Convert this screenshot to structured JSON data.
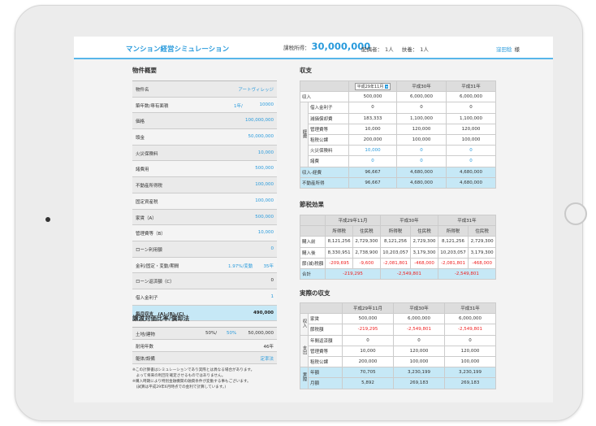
{
  "header": {
    "app_title": "マンション経営シミュレーション",
    "income_label": "課税所得：",
    "income_value": "30,000,000",
    "spouse_label": "配偶者：",
    "spouse_value": "1人",
    "dependents_label": "扶養：",
    "dependents_value": "1人",
    "user_name": "窪田稔",
    "honorific": "様"
  },
  "property": {
    "title": "物件概要",
    "name_label": "物件名",
    "name_value": "アートヴィレッジ",
    "age_label": "築年数/専有面積",
    "age_value": "1年/",
    "area_value": "10000",
    "price_label": "価格",
    "price_value": "100,000,000",
    "down_label": "頭金",
    "down_value": "50,000,000",
    "fire_label": "火災保険料",
    "fire_value": "10,000",
    "misc_label": "諸費用",
    "misc_value": "500,000",
    "acq_label": "不動産所得税",
    "acq_value": "100,000",
    "fixed_label": "固定資産税",
    "fixed_value": "100,000",
    "rent_label": "家賃（A）",
    "rent_value": "500,000",
    "mgmt_label": "管理費等（B）",
    "mgmt_value": "10,000",
    "loan_use_label": "ローン利用額",
    "loan_use_value": "0",
    "rate_label": "金利/固定・変動/期間",
    "rate_value": "1.97%/変動",
    "rate_years": "35年",
    "repay_label": "ローン返済額（C）",
    "repay_value": "0",
    "interest_label": "借入金利子",
    "interest_value": "1",
    "monthly_label": "毎月収支　(A)-(B)-(C)",
    "monthly_value": "490,000"
  },
  "depr": {
    "title": "譲渡対価比率/償却法",
    "land_label": "土地/建物",
    "land_pct": "50%/",
    "bldg_pct": "50%",
    "land_value": "50,000,000",
    "life_label": "耐用年数",
    "life_value": "46年",
    "method_label": "躯体/設備",
    "method_value": "定率法"
  },
  "notes": [
    "※この計算書はシミュレーションであり実際とは異なる場合があります。",
    "　よって将来の利回を確定させるものではありません。",
    "※購入時期により特別金融機関の融資条件が変動する事もございます。",
    "　(試算は平成29年6月時点での金利で計算しています。)"
  ],
  "income": {
    "title": "収支",
    "select_value": "平成29年11月",
    "cols": [
      "平成30年",
      "平成31年"
    ],
    "rows": [
      {
        "label": "収入",
        "values": [
          "500,000",
          "6,000,000",
          "6,000,000"
        ]
      },
      {
        "label": "借入金利子",
        "values": [
          "0",
          "0",
          "0"
        ]
      },
      {
        "label": "減価償却費",
        "values": [
          "183,333",
          "1,100,000",
          "1,100,000"
        ]
      },
      {
        "label": "管理費等",
        "values": [
          "10,000",
          "120,000",
          "120,000"
        ]
      },
      {
        "label": "租税公課",
        "values": [
          "200,000",
          "100,000",
          "100,000"
        ]
      },
      {
        "label": "火災保険料",
        "values": [
          "10,000",
          "0",
          "0"
        ]
      },
      {
        "label": "諸費",
        "values": [
          "0",
          "0",
          "0"
        ]
      }
    ],
    "expense_side": "経費",
    "sum_rows": [
      {
        "label": "収入-経費",
        "values": [
          "96,667",
          "4,680,000",
          "4,680,000"
        ]
      },
      {
        "label": "不動産所得",
        "values": [
          "96,667",
          "4,680,000",
          "4,680,000"
        ]
      }
    ]
  },
  "tax": {
    "title": "節税効果",
    "years": [
      "平成29年11月",
      "平成30年",
      "平成31年"
    ],
    "sub": [
      "所得税",
      "住民税"
    ],
    "rows": [
      {
        "label": "購入前",
        "values": [
          "8,121,256",
          "2,729,300",
          "8,121,256",
          "2,729,300",
          "8,121,256",
          "2,729,300"
        ]
      },
      {
        "label": "購入後",
        "values": [
          "8,330,951",
          "2,738,900",
          "10,203,057",
          "3,179,300",
          "10,203,057",
          "3,179,300"
        ]
      },
      {
        "label": "節(減)税額",
        "values": [
          "-209,695",
          "-9,600",
          "-2,081,801",
          "-468,000",
          "-2,081,801",
          "-468,000"
        ]
      }
    ],
    "total_label": "合計",
    "totals": [
      "-219,295",
      "-2,549,801",
      "-2,549,801"
    ]
  },
  "actual": {
    "title": "実際の収支",
    "cols": [
      "平成29年11月",
      "平成30年",
      "平成31年"
    ],
    "income_side": "収入",
    "expense_side": "支出",
    "total_side": "実際",
    "income_rows": [
      {
        "label": "家賃",
        "values": [
          "500,000",
          "6,000,000",
          "6,000,000"
        ]
      },
      {
        "label": "節税額",
        "values": [
          "-219,295",
          "-2,549,801",
          "-2,549,801"
        ]
      }
    ],
    "expense_rows": [
      {
        "label": "年間返済額",
        "values": [
          "0",
          "0",
          "0"
        ]
      },
      {
        "label": "管理費等",
        "values": [
          "10,000",
          "120,000",
          "120,000"
        ]
      },
      {
        "label": "租税公課",
        "values": [
          "200,000",
          "100,000",
          "100,000"
        ]
      }
    ],
    "sum_rows": [
      {
        "label": "年額",
        "values": [
          "70,705",
          "3,230,199",
          "3,230,199"
        ]
      },
      {
        "label": "月額",
        "values": [
          "5,892",
          "269,183",
          "269,183"
        ]
      }
    ]
  },
  "colors": {
    "accent": "#2a9bdc",
    "highlight": "#c6e8f6",
    "negative": "#e22222"
  }
}
